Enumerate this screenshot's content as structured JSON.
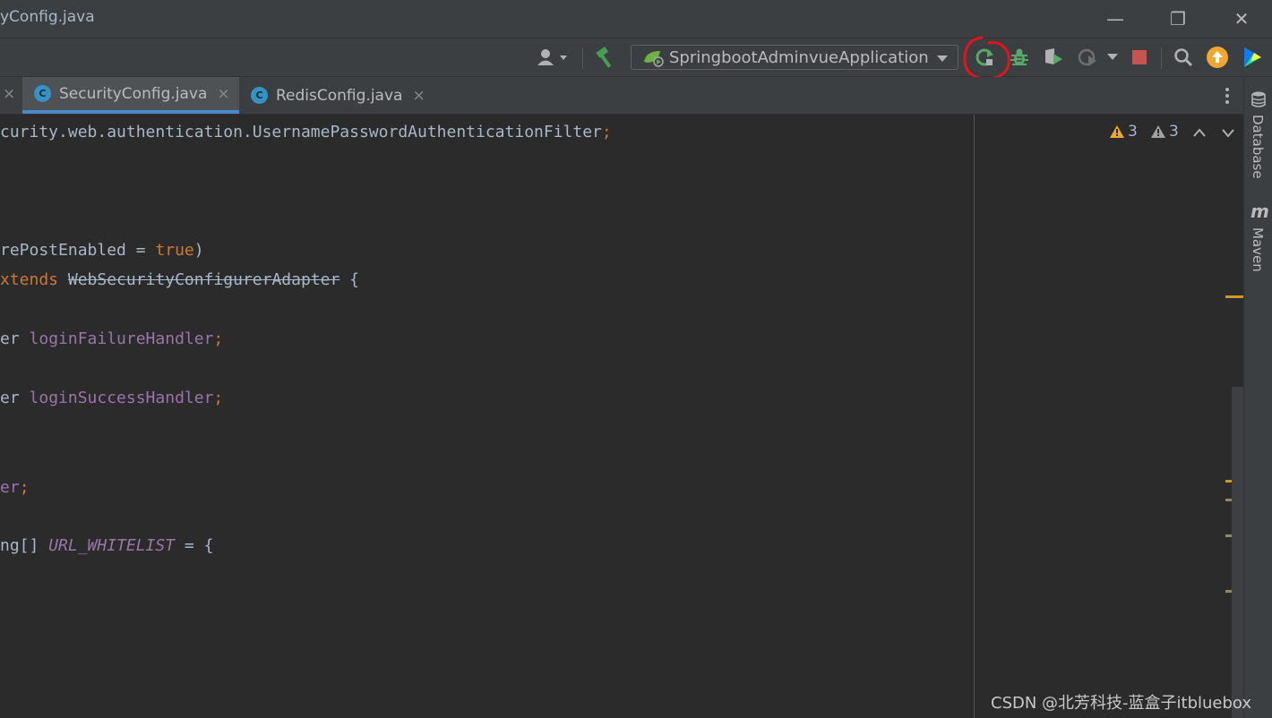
{
  "window": {
    "title": "yConfig.java",
    "min_glyph": "—",
    "restore_glyph": "❐",
    "close_glyph": "✕"
  },
  "toolbar": {
    "run_config": "SpringbootAdminvueApplication",
    "icons": [
      "user-icon",
      "build-hammer-icon",
      "rerun-icon",
      "debug-bug-icon",
      "coverage-icon",
      "profiler-icon",
      "stop-icon",
      "search-icon",
      "update-icon",
      "jetbrains-toolbox-icon"
    ],
    "colors": {
      "build": "#499c54",
      "stop": "#c75450",
      "update": "#f0a732"
    }
  },
  "tabs": [
    {
      "label": "SecurityConfig.java",
      "active": true
    },
    {
      "label": "RedisConfig.java",
      "active": false
    }
  ],
  "tab_close_glyph": "×",
  "code": {
    "line1a": "curity.web.authentication.UsernamePasswordAuthenticationFilter",
    "line1b": ";",
    "line2a": "rePostEnabled = ",
    "line2b": "true",
    "line2c": ")",
    "line3a": "xtends",
    "line3b": " ",
    "line3c": "WebSecurityConfigurerAdapter",
    "line3d": " {",
    "line4a": "er ",
    "line4b": "loginFailureHandler",
    "line4c": ";",
    "line5a": "er ",
    "line5b": "loginSuccessHandler",
    "line5c": ";",
    "line6a": "er",
    "line6b": ";",
    "line7a": "ng[] ",
    "line7b": "URL_WHITELIST",
    "line7c": " = {"
  },
  "inspections": {
    "warnings": "3",
    "weak_warnings": "3"
  },
  "sidebar": {
    "database": "Database",
    "maven": "Maven",
    "maven_glyph": "m"
  },
  "watermark": "CSDN @北芳科技-蓝盒子itbluebox",
  "colors": {
    "keyword": "#cc7832",
    "field": "#9876aa",
    "text": "#a9b7c6",
    "background": "#2b2b2b",
    "panel": "#3c3f41"
  }
}
